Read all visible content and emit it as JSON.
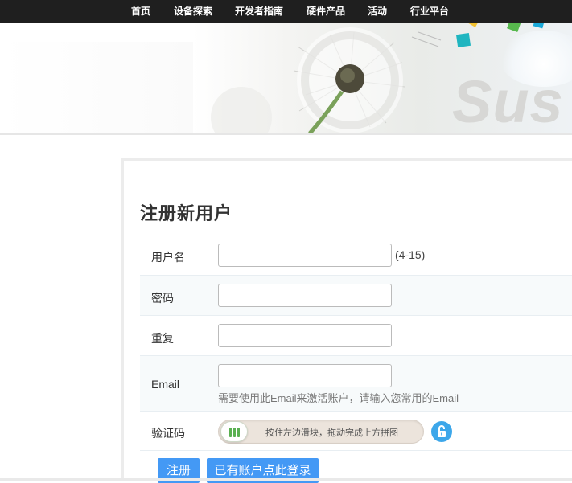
{
  "nav": {
    "items": [
      {
        "label": "首页"
      },
      {
        "label": "设备探索"
      },
      {
        "label": "开发者指南"
      },
      {
        "label": "硬件产品"
      },
      {
        "label": "活动"
      },
      {
        "label": "行业平台"
      }
    ]
  },
  "banner": {
    "text": "Sus"
  },
  "form": {
    "title": "注册新用户",
    "username": {
      "label": "用户名",
      "value": "",
      "hint": "(4-15)"
    },
    "password": {
      "label": "密码",
      "value": ""
    },
    "repeat": {
      "label": "重复",
      "value": ""
    },
    "email": {
      "label": "Email",
      "value": "",
      "note": "需要使用此Email来激活账户，请输入您常用的Email"
    },
    "captcha": {
      "label": "验证码",
      "slider_text": "按住左边滑块，拖动完成上方拼图",
      "lock_icon": "lock-icon"
    },
    "register_button": "注册",
    "login_button": "已有账户点此登录"
  },
  "colors": {
    "nav_bg": "#1f1f1f",
    "button": "#4499f5",
    "lock": "#3da7ea",
    "slider_handle_bars": "#59b050"
  }
}
